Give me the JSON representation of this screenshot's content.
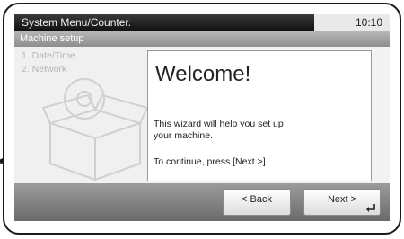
{
  "header": {
    "path": "System Menu/Counter.",
    "time": "10:10",
    "section": "Machine setup"
  },
  "steps": [
    "1. Date/Time",
    "2. Network"
  ],
  "welcome": {
    "title": "Welcome!",
    "line1": "This wizard will help you set up",
    "line2": "your machine.",
    "line3": "To continue, press [Next >]."
  },
  "buttons": {
    "back": "< Back",
    "next": "Next >"
  },
  "icons": {
    "enter": "enter-icon",
    "cable": "cable-icon"
  }
}
